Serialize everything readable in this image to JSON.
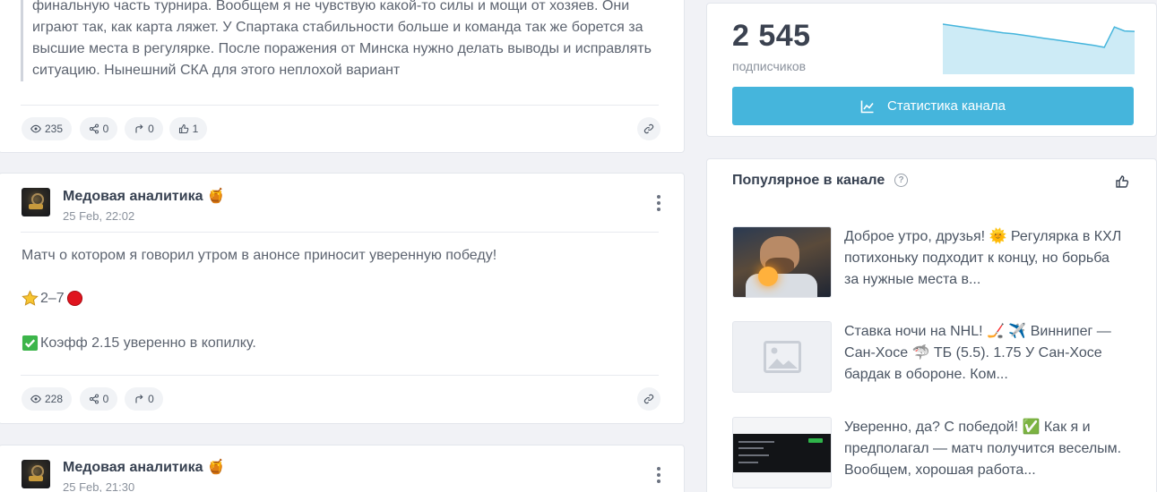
{
  "posts": [
    {
      "text_lines": [
        "финальную часть турнира. Вообщем я не чувствую какой-то силы и мощи от хозяев. Они",
        "играют так, как карта ляжет. У Спартака стабильности больше и команда так же борется за",
        "высшие места в регулярке. После поражения от Минска нужно делать выводы и исправлять",
        "ситуацию. Нынешний СКА для этого неплохой вариант"
      ],
      "views": "235",
      "shares": "0",
      "forwards": "0",
      "likes": "1"
    },
    {
      "author": "Медовая аналитика",
      "author_emoji": "🍯",
      "date": "25 Feb, 22:02",
      "line1": "Матч о котором я говорил утром в анонсе приносит уверенную победу!",
      "line2": "2–7",
      "line3": "Коэфф 2.15 уверенно в копилку.",
      "views": "228",
      "shares": "0",
      "forwards": "0"
    },
    {
      "author": "Медовая аналитика",
      "author_emoji": "🍯",
      "date": "25 Feb, 21:30"
    }
  ],
  "channel_stats": {
    "subscribers": "2 545",
    "subscribers_label": "подписчиков",
    "button_label": "Статистика канала",
    "accent_color": "#45b5dc",
    "sparkline": [
      100,
      97,
      94,
      91,
      88,
      85,
      82,
      80,
      77,
      74,
      71,
      68,
      65,
      62,
      59,
      56,
      52,
      94,
      86,
      85
    ]
  },
  "popular": {
    "title": "Популярное в канале",
    "help_icon": "?",
    "items": [
      {
        "lines": [
          "Доброе утро, друзья! 🌞 Регулярка в КХЛ",
          "потихоньку подходит к концу, но борьба",
          "за нужные места в..."
        ]
      },
      {
        "lines": [
          "Ставка ночи на NHL! 🏒 ✈️ Виннипег —",
          "Сан-Хосе 🦈 ТБ (5.5). 1.75 У Сан-Хосе",
          "бардак в обороне. Ком..."
        ]
      },
      {
        "lines": [
          "Уверенно, да? С победой! ✅ Как я и",
          "предполагал — матч получится веселым.",
          "Вообщем, хорошая работа..."
        ]
      }
    ]
  }
}
